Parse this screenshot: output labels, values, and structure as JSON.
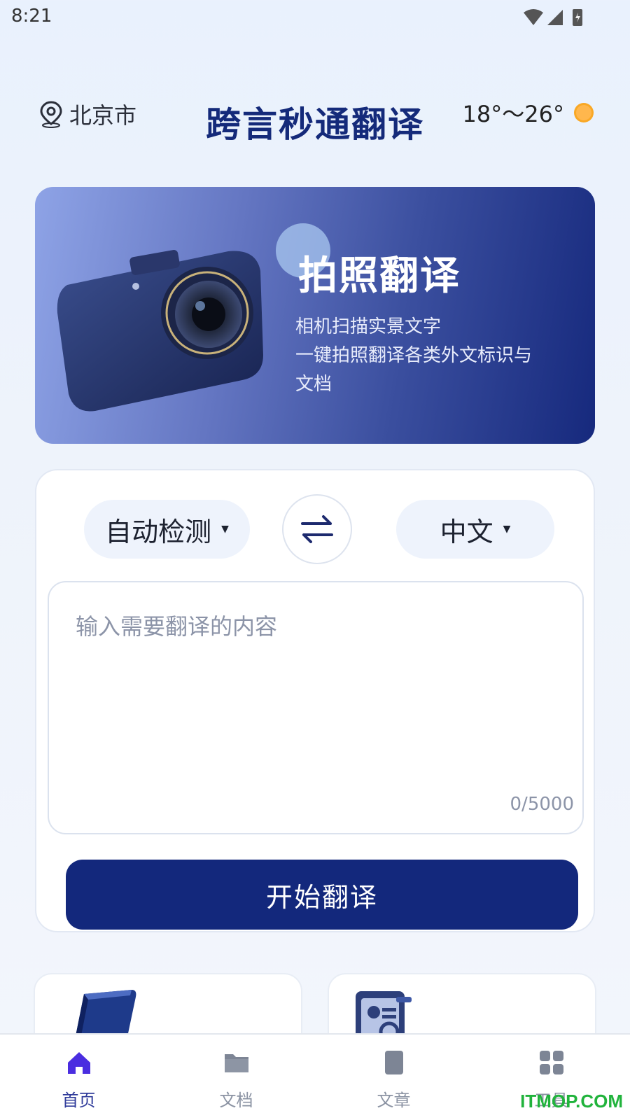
{
  "status_bar": {
    "time": "8:21"
  },
  "header": {
    "location": "北京市",
    "title": "跨言秒通翻译",
    "weather": "18°～26°"
  },
  "banner": {
    "title": "拍照翻译",
    "desc_lines": [
      "相机扫描实景文字",
      "一键拍照翻译各类外文标识与",
      "文档"
    ]
  },
  "translator": {
    "source_lang": "自动检测",
    "target_lang": "中文",
    "input_placeholder": "输入需要翻译的内容",
    "char_counter": "0/5000",
    "start_button": "开始翻译"
  },
  "tabbar": {
    "items": [
      {
        "label": "首页",
        "icon": "home-icon",
        "active": true
      },
      {
        "label": "文档",
        "icon": "folder-icon",
        "active": false
      },
      {
        "label": "文章",
        "icon": "document-icon",
        "active": false
      },
      {
        "label": "工具",
        "icon": "grid-icon",
        "active": false
      }
    ]
  },
  "watermark": "ITMOP.COM",
  "colors": {
    "primary": "#13287c",
    "title": "#142a7a",
    "active_tab": "#4a2de0",
    "watermark": "#21b33c"
  }
}
